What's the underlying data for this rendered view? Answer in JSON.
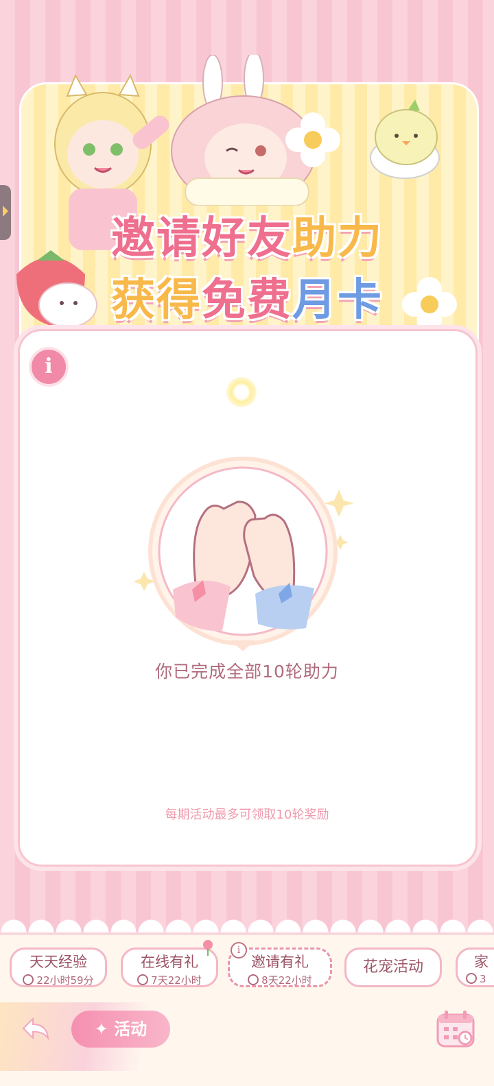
{
  "banner": {
    "title_part1a": "邀请好友",
    "title_part1b": "助力",
    "title_part2a": "获得",
    "title_part2b": "免费",
    "title_part2c": "月卡"
  },
  "card": {
    "status_text": "你已完成全部10轮助力",
    "footnote": "每期活动最多可领取10轮奖励"
  },
  "tabs": [
    {
      "name": "天天经验",
      "time": "22小时59分"
    },
    {
      "name": "在线有礼",
      "time": "7天22小时"
    },
    {
      "name": "邀请有礼",
      "time": "8天22小时"
    },
    {
      "name": "花宠活动"
    },
    {
      "name": "家",
      "time": "3"
    }
  ],
  "bottom": {
    "activity_label": "活动"
  },
  "colors": {
    "pink": "#ef6f8e",
    "yellow": "#f8b94a",
    "blue": "#6f9be3"
  }
}
